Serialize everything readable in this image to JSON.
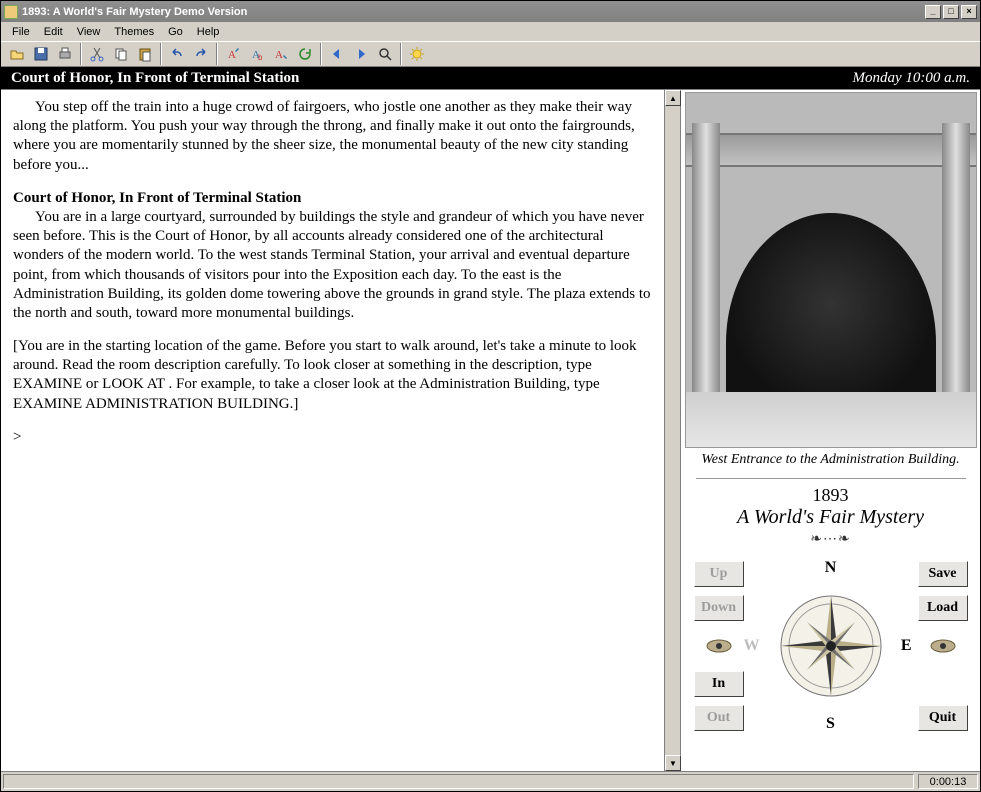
{
  "title": "1893: A World's Fair Mystery Demo Version",
  "menus": {
    "file": "File",
    "edit": "Edit",
    "view": "View",
    "themes": "Themes",
    "go": "Go",
    "help": "Help"
  },
  "location": {
    "name": "Court of Honor, In Front of Terminal Station",
    "time": "Monday 10:00 a.m."
  },
  "story": {
    "para1": "You step off the train into a huge crowd of fairgoers, who jostle one another as they make their way along the platform. You push your way through the throng, and finally make it out onto the fairgrounds, where you are momentarily stunned by the sheer size, the monumental beauty of the new city standing before you...",
    "roomtitle": "Court of Honor, In Front of Terminal Station",
    "para2": "You are in a large courtyard, surrounded by buildings the style and grandeur of which you have never seen before. This is the Court of Honor, by all accounts already considered one of the architectural wonders of the modern world. To the west stands Terminal Station, your arrival and eventual departure point, from which thousands of visitors pour into the Exposition each day. To the east is the Administration Building, its golden dome towering above the grounds in grand style. The plaza extends to the north and south, toward more monumental buildings.",
    "para3": "[You are in the starting location of the game. Before you start to walk around, let's take a minute to look around. Read the room description carefully. To look closer at something in the description, type EXAMINE or LOOK AT . For example, to take a closer look at the Administration Building, type EXAMINE ADMINISTRATION BUILDING.]",
    "prompt": ">"
  },
  "caption": "West Entrance to the Administration Building.",
  "game": {
    "year": "1893",
    "subtitle": "A World's Fair Mystery"
  },
  "nav": {
    "up": "Up",
    "down": "Down",
    "in": "In",
    "out": "Out",
    "save": "Save",
    "load": "Load",
    "quit": "Quit",
    "n": "N",
    "s": "S",
    "e": "E",
    "w": "W"
  },
  "status": {
    "time": "0:00:13"
  }
}
